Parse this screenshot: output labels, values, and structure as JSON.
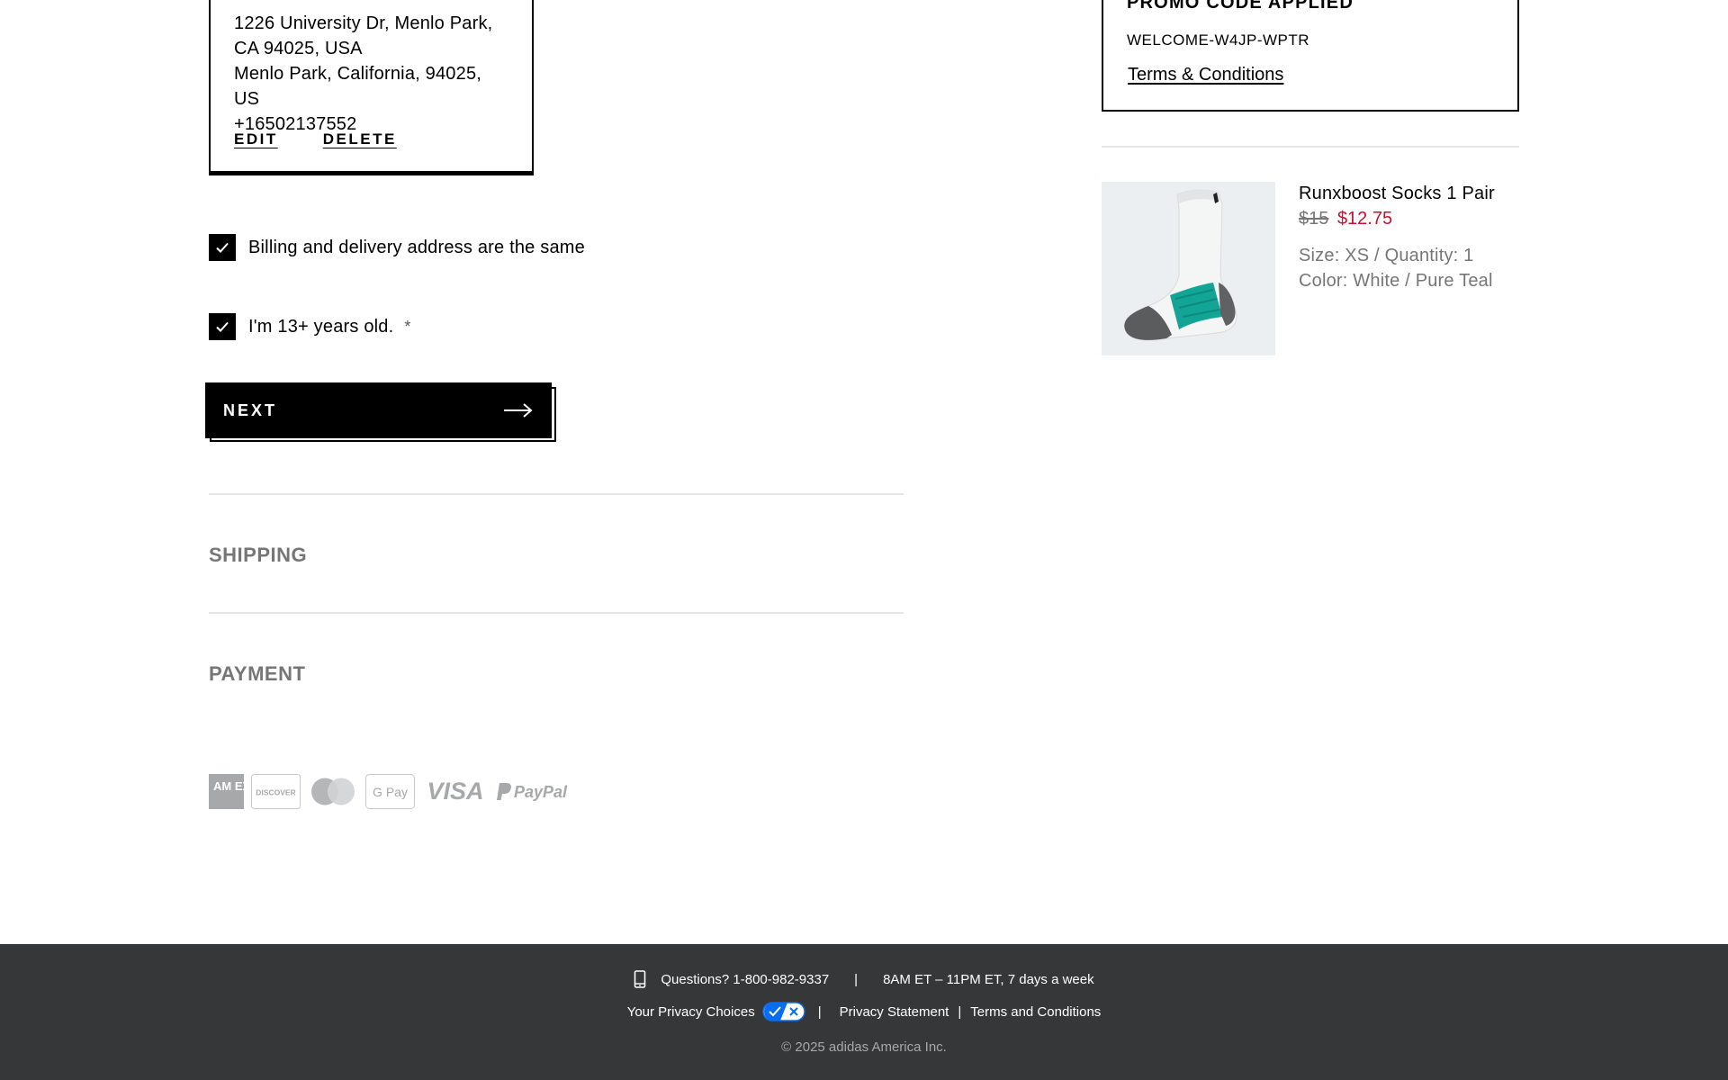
{
  "billing_address": {
    "lines": [
      "1226 University Dr, Menlo Park,",
      "CA 94025, USA",
      "Menlo Park, California, 94025, US",
      "+16502137552"
    ],
    "edit_label": "EDIT",
    "delete_label": "DELETE"
  },
  "checkboxes": {
    "same_address": {
      "label": "Billing and delivery address are the same",
      "checked": true
    },
    "age_confirm": {
      "label": "I'm 13+ years old.",
      "required_mark": "*",
      "checked": true
    }
  },
  "next_button": {
    "label": "NEXT",
    "icon": "arrow-right-icon"
  },
  "sections": {
    "shipping": "SHIPPING",
    "payment": "PAYMENT"
  },
  "payment_methods": [
    "American Express",
    "Discover",
    "Mastercard",
    "Google Pay",
    "Visa",
    "PayPal"
  ],
  "payment_logo_text": {
    "amex": "AM EX",
    "discover": "DISCOVER",
    "gpay": "G Pay",
    "visa": "VISA",
    "paypal": "PayPal"
  },
  "promo": {
    "heading": "PROMO CODE APPLIED",
    "code": "WELCOME-W4JP-WPTR",
    "terms_label": "Terms & Conditions"
  },
  "cart_item": {
    "name": "Runxboost Socks 1 Pair",
    "price_original": "$15",
    "price_sale": "$12.75",
    "size_quantity": "Size: XS / Quantity: 1",
    "color": "Color: White / Pure Teal"
  },
  "footer": {
    "questions": "Questions? 1-800-982-9337",
    "divider": "|",
    "hours": "8AM ET – 11PM ET, 7 days a week",
    "privacy_choices": "Your Privacy Choices",
    "privacy_statement": "Privacy Statement",
    "terms": "Terms and Conditions",
    "copyright": "© 2025 adidas America Inc."
  },
  "colors": {
    "primary": "#000000",
    "sale_price": "#c8102e",
    "muted_text": "#767677",
    "footer_bg": "#363739",
    "privacy_toggle": "#0a6cf0"
  }
}
